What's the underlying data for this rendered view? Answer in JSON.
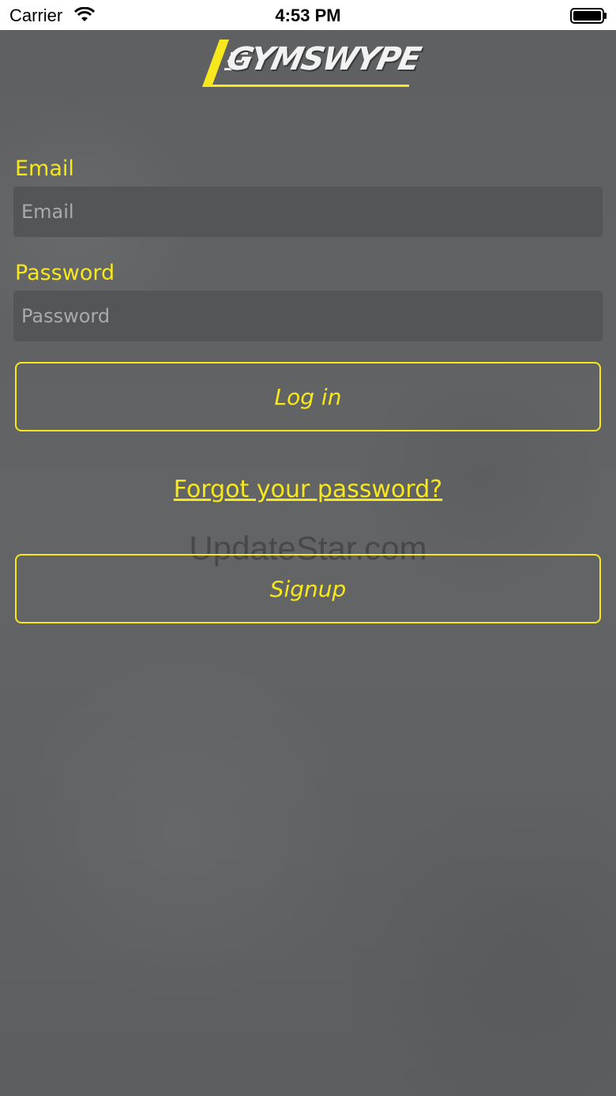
{
  "status_bar": {
    "carrier": "Carrier",
    "time": "4:53 PM"
  },
  "logo": {
    "text": "GYMSWYPE"
  },
  "form": {
    "email_label": "Email",
    "email_placeholder": "Email",
    "password_label": "Password",
    "password_placeholder": "Password",
    "login_label": "Log in",
    "forgot_label": "Forgot your password?",
    "signup_label": "Signup"
  },
  "watermark": "UpdateStar.com",
  "colors": {
    "accent": "#f7e81e",
    "background": "#5f6163",
    "field": "#545557"
  }
}
